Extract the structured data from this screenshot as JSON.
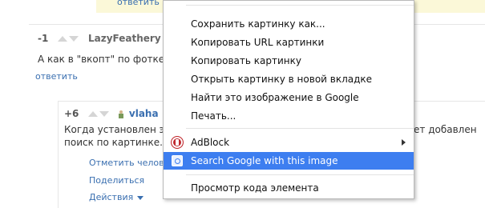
{
  "top": {
    "reply_link": "ответить"
  },
  "comment1": {
    "score": "-1",
    "user": "LazyFeathery",
    "user_suffix": "от",
    "text": "А как в \"вкопт\" по фотке и",
    "reply": "ответить"
  },
  "comment2": {
    "score": "+6",
    "user": "vlaha",
    "text_line1_left": "Когда установлен эт",
    "text_line1_right": "ет добавлен",
    "text_line2": "поиск по картинке.",
    "actions": [
      "Отметить человек",
      "Поделиться",
      "Действия"
    ]
  },
  "menu": {
    "items": [
      {
        "label": "Сохранить картинку как..."
      },
      {
        "label": "Копировать URL картинки"
      },
      {
        "label": "Копировать картинку"
      },
      {
        "label": "Открыть картинку в новой вкладке"
      },
      {
        "label": "Найти это изображение в Google"
      },
      {
        "label": "Печать..."
      }
    ],
    "adblock": {
      "label": "AdBlock",
      "icon": "adblock-icon"
    },
    "search_google": {
      "label": "Search Google with this image",
      "icon": "search-by-image-icon"
    },
    "inspect": {
      "label": "Просмотр кода элемента"
    }
  },
  "colors": {
    "highlight": "#3d7ef0",
    "link": "#3a6fb0",
    "adblock": "#c0272d"
  }
}
